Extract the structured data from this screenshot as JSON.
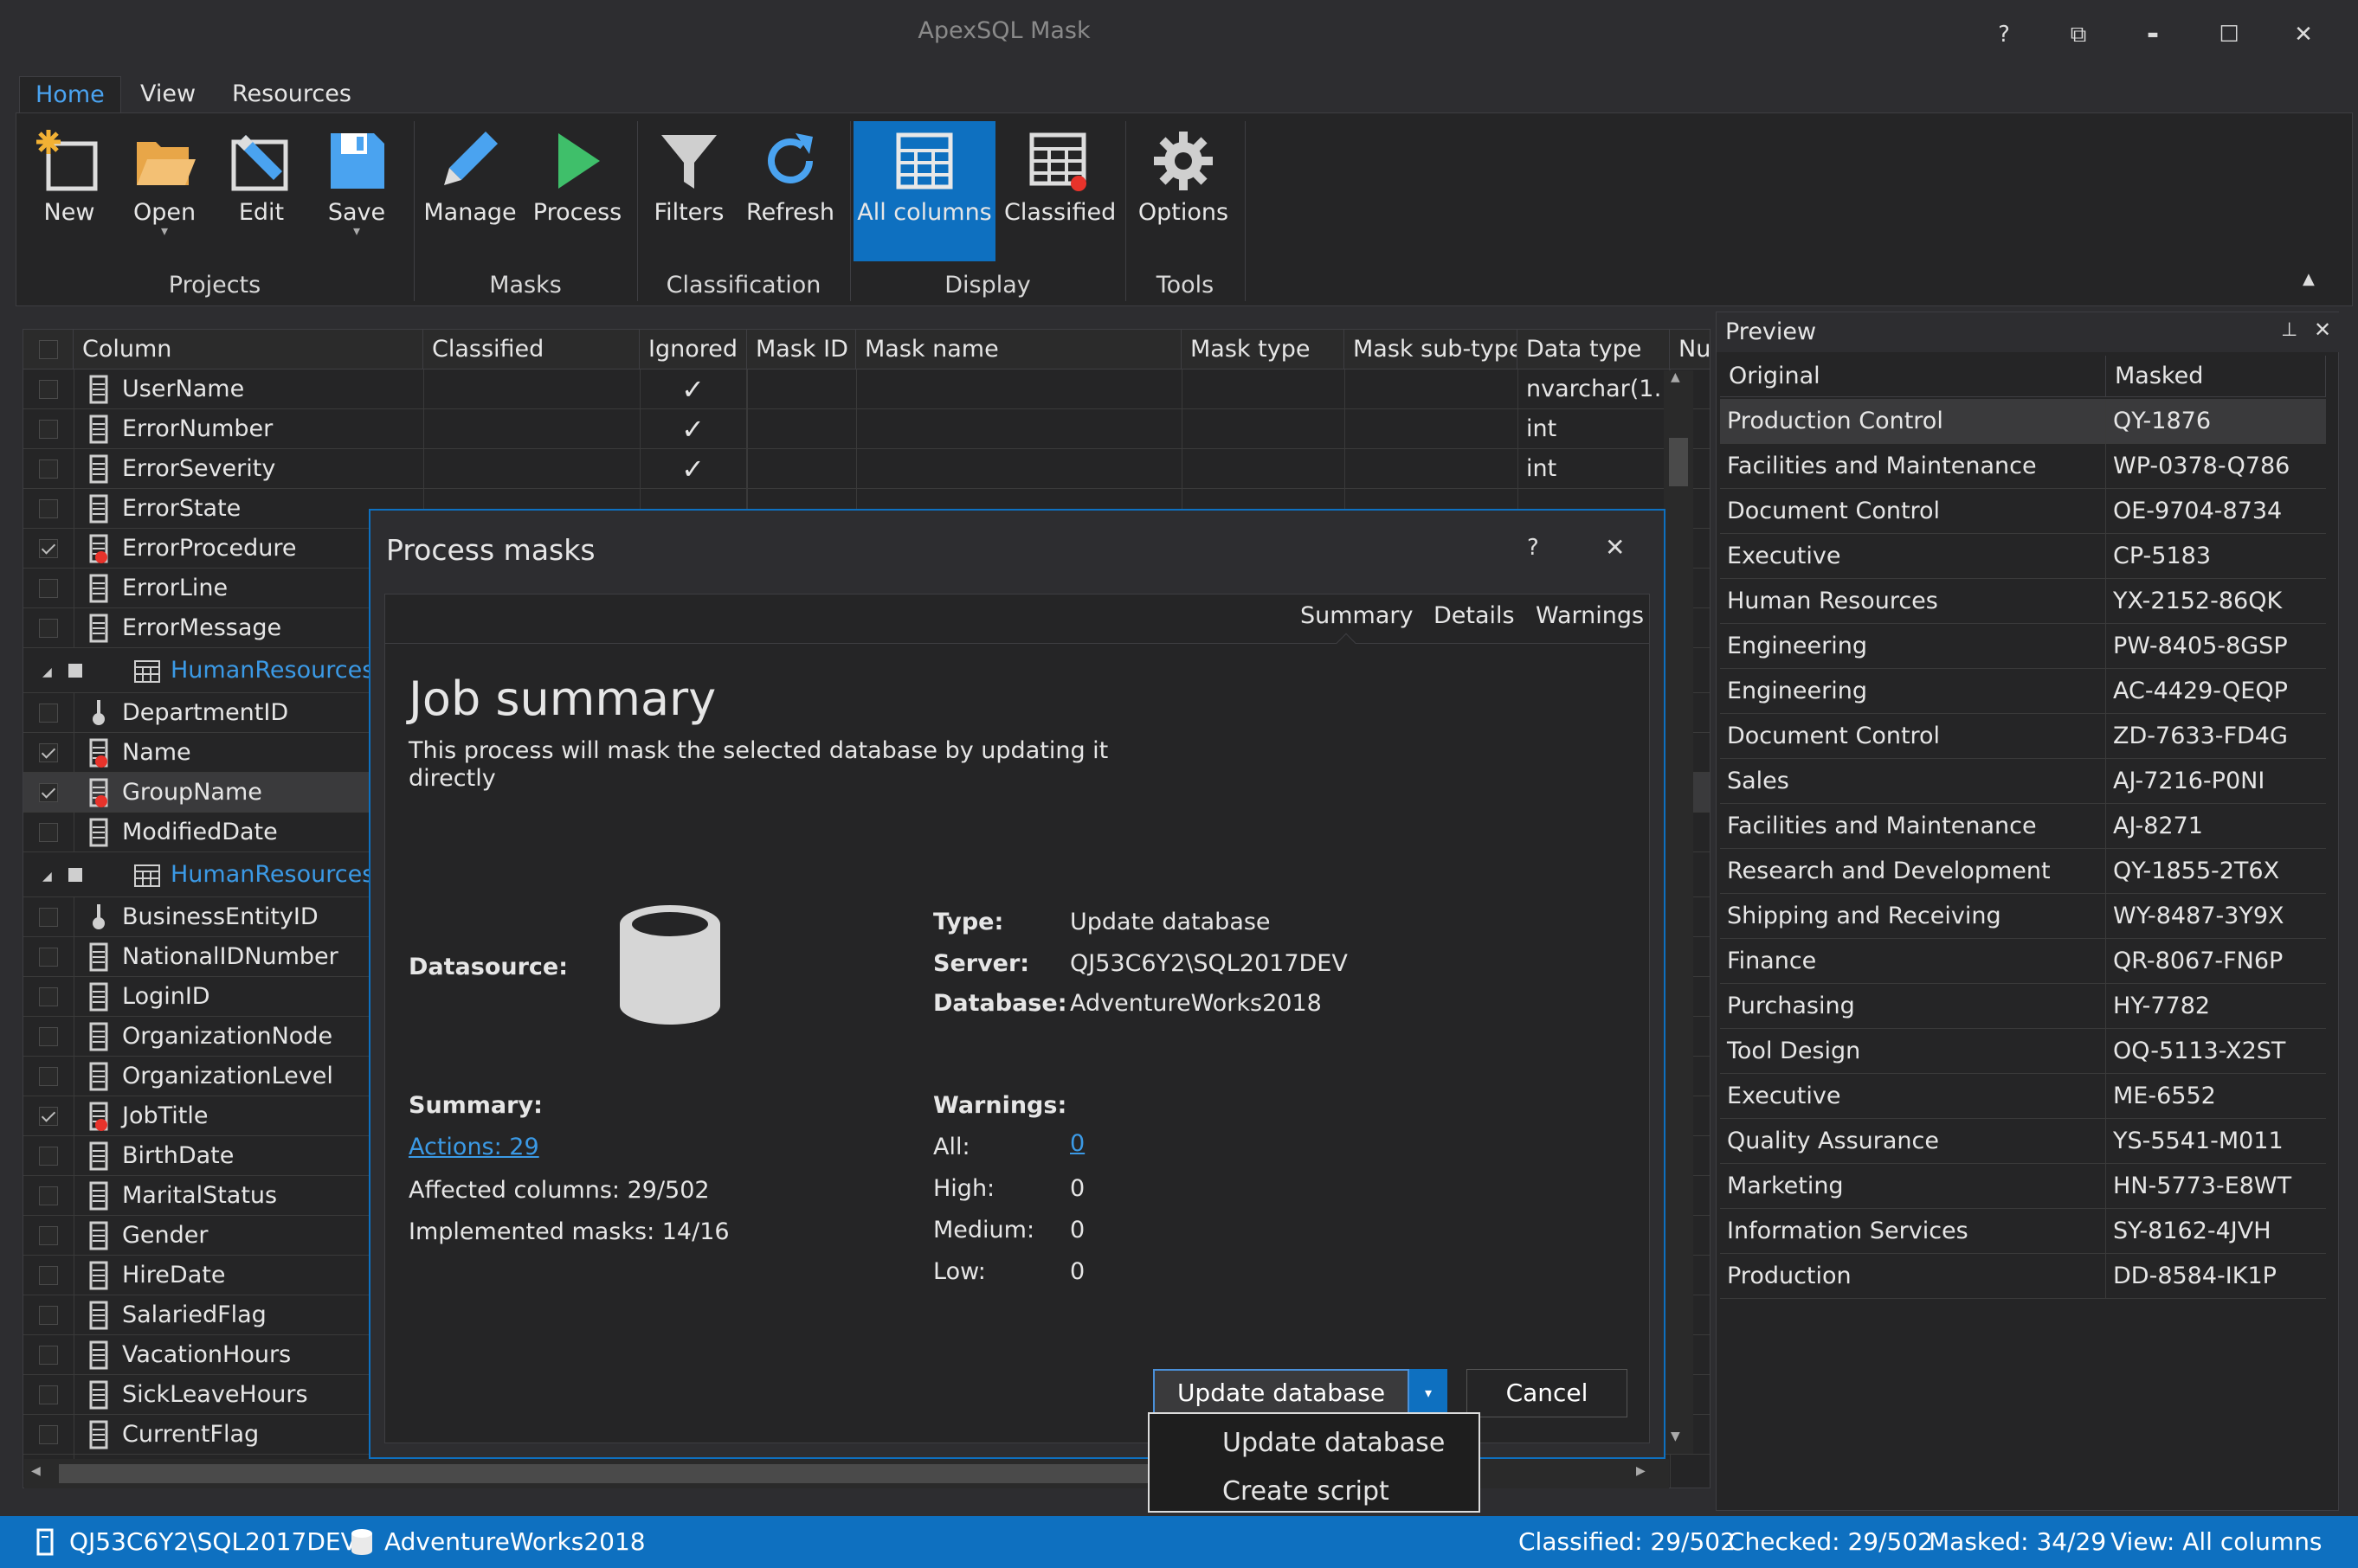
{
  "app": {
    "title": "ApexSQL Mask",
    "help_glyph": "?",
    "restore_glyph": "⧉",
    "minimize_glyph": "▬",
    "maximize_glyph": "☐",
    "close_glyph": "✕"
  },
  "tabs": [
    {
      "label": "Home"
    },
    {
      "label": "View"
    },
    {
      "label": "Resources"
    }
  ],
  "ribbon": {
    "buttons": {
      "new": "New",
      "open": "Open",
      "edit": "Edit",
      "save": "Save",
      "manage": "Manage",
      "process": "Process",
      "filters": "Filters",
      "refresh": "Refresh",
      "all_columns": "All columns",
      "classified": "Classified",
      "options": "Options"
    },
    "groups": {
      "projects": "Projects",
      "masks": "Masks",
      "classification": "Classification",
      "display": "Display",
      "tools": "Tools"
    },
    "drop_glyph": "▾",
    "collapse_glyph": "▲"
  },
  "grid": {
    "headers": [
      "Column",
      "Classified",
      "Ignored",
      "Mask ID",
      "Mask name",
      "Mask type",
      "Mask sub-type",
      "Data type",
      "Nulla"
    ],
    "rows": [
      {
        "name": "UserName",
        "checked": false,
        "icon": "column",
        "ignored": "✓",
        "data_type": "nvarchar(1…"
      },
      {
        "name": "ErrorNumber",
        "checked": false,
        "icon": "column",
        "ignored": "✓",
        "data_type": "int"
      },
      {
        "name": "ErrorSeverity",
        "checked": false,
        "icon": "column",
        "ignored": "✓",
        "data_type": "int"
      },
      {
        "name": "ErrorState",
        "checked": false,
        "icon": "column",
        "ignored": "",
        "data_type": ""
      },
      {
        "name": "ErrorProcedure",
        "checked": true,
        "icon": "column-masked",
        "ignored": "",
        "data_type": ""
      },
      {
        "name": "ErrorLine",
        "checked": false,
        "icon": "column",
        "ignored": "",
        "data_type": ""
      },
      {
        "name": "ErrorMessage",
        "checked": false,
        "icon": "column",
        "ignored": "",
        "data_type": ""
      }
    ],
    "group1": {
      "name": "HumanResources.D",
      "expand_glyph": "◢"
    },
    "rows2": [
      {
        "name": "DepartmentID",
        "checked": false,
        "icon": "key"
      },
      {
        "name": "Name",
        "checked": true,
        "icon": "column-masked"
      },
      {
        "name": "GroupName",
        "checked": true,
        "icon": "column-masked"
      },
      {
        "name": "ModifiedDate",
        "checked": false,
        "icon": "column"
      }
    ],
    "group2": {
      "name": "HumanResources.E",
      "expand_glyph": "◢"
    },
    "rows3": [
      {
        "name": "BusinessEntityID",
        "checked": false,
        "icon": "key"
      },
      {
        "name": "NationalIDNumber",
        "checked": false,
        "icon": "column"
      },
      {
        "name": "LoginID",
        "checked": false,
        "icon": "column"
      },
      {
        "name": "OrganizationNode",
        "checked": false,
        "icon": "column"
      },
      {
        "name": "OrganizationLevel",
        "checked": false,
        "icon": "column"
      },
      {
        "name": "JobTitle",
        "checked": true,
        "icon": "column-masked"
      },
      {
        "name": "BirthDate",
        "checked": false,
        "icon": "column"
      },
      {
        "name": "MaritalStatus",
        "checked": false,
        "icon": "column"
      },
      {
        "name": "Gender",
        "checked": false,
        "icon": "column"
      },
      {
        "name": "HireDate",
        "checked": false,
        "icon": "column"
      },
      {
        "name": "SalariedFlag",
        "checked": false,
        "icon": "column"
      },
      {
        "name": "VacationHours",
        "checked": false,
        "icon": "column"
      },
      {
        "name": "SickLeaveHours",
        "checked": false,
        "icon": "column"
      },
      {
        "name": "CurrentFlag",
        "checked": false,
        "icon": "column"
      }
    ],
    "scroll_up_glyph": "▲",
    "scroll_down_glyph": "▼",
    "scroll_left_glyph": "◀",
    "scroll_right_glyph": "▶"
  },
  "preview": {
    "title": "Preview",
    "pin_glyph": "⊥",
    "close_glyph": "✕",
    "headers": [
      "Original",
      "Masked"
    ],
    "rows": [
      [
        "Production Control",
        "QY-1876"
      ],
      [
        "Facilities and Maintenance",
        "WP-0378-Q786"
      ],
      [
        "Document Control",
        "OE-9704-8734"
      ],
      [
        "Executive",
        "CP-5183"
      ],
      [
        "Human Resources",
        "YX-2152-86QK"
      ],
      [
        "Engineering",
        "PW-8405-8GSP"
      ],
      [
        "Engineering",
        "AC-4429-QEQP"
      ],
      [
        "Document Control",
        "ZD-7633-FD4G"
      ],
      [
        "Sales",
        "AJ-7216-P0NI"
      ],
      [
        "Facilities and Maintenance",
        "AJ-8271"
      ],
      [
        "Research and Development",
        "QY-1855-2T6X"
      ],
      [
        "Shipping and Receiving",
        "WY-8487-3Y9X"
      ],
      [
        "Finance",
        "QR-8067-FN6P"
      ],
      [
        "Purchasing",
        "HY-7782"
      ],
      [
        "Tool Design",
        "OQ-5113-X2ST"
      ],
      [
        "Executive",
        "ME-6552"
      ],
      [
        "Quality Assurance",
        "YS-5541-M011"
      ],
      [
        "Marketing",
        "HN-5773-E8WT"
      ],
      [
        "Information Services",
        "SY-8162-4JVH"
      ],
      [
        "Production",
        "DD-8584-IK1P"
      ]
    ]
  },
  "dialog": {
    "title": "Process masks",
    "help_glyph": "?",
    "close_glyph": "✕",
    "tabs": [
      "Summary",
      "Details",
      "Warnings"
    ],
    "heading": "Job summary",
    "description_line1": "This process will mask the selected database by updating it",
    "description_line2": "directly",
    "datasource_label": "Datasource:",
    "type_label": "Type:",
    "type_value": "Update database",
    "server_label": "Server:",
    "server_value": "QJ53C6Y2\\SQL2017DEV",
    "database_label": "Database:",
    "database_value": "AdventureWorks2018",
    "summary_label": "Summary:",
    "actions_link": "Actions: 29",
    "affected_columns": "Affected columns: 29/502",
    "implemented_masks": "Implemented masks: 14/16",
    "warnings_label": "Warnings:",
    "warnings": [
      {
        "label": "All:",
        "value": "0"
      },
      {
        "label": "High:",
        "value": "0"
      },
      {
        "label": "Medium:",
        "value": "0"
      },
      {
        "label": "Low:",
        "value": "0"
      }
    ],
    "update_button": "Update database",
    "cancel_button": "Cancel",
    "dropdown": [
      "Update database",
      "Create script"
    ]
  },
  "status": {
    "server": "QJ53C6Y2\\SQL2017DEV",
    "database": "AdventureWorks2018",
    "classified": "Classified: 29/502",
    "checked": "Checked: 29/502",
    "masked": "Masked: 34/29",
    "view": "View: All columns"
  }
}
